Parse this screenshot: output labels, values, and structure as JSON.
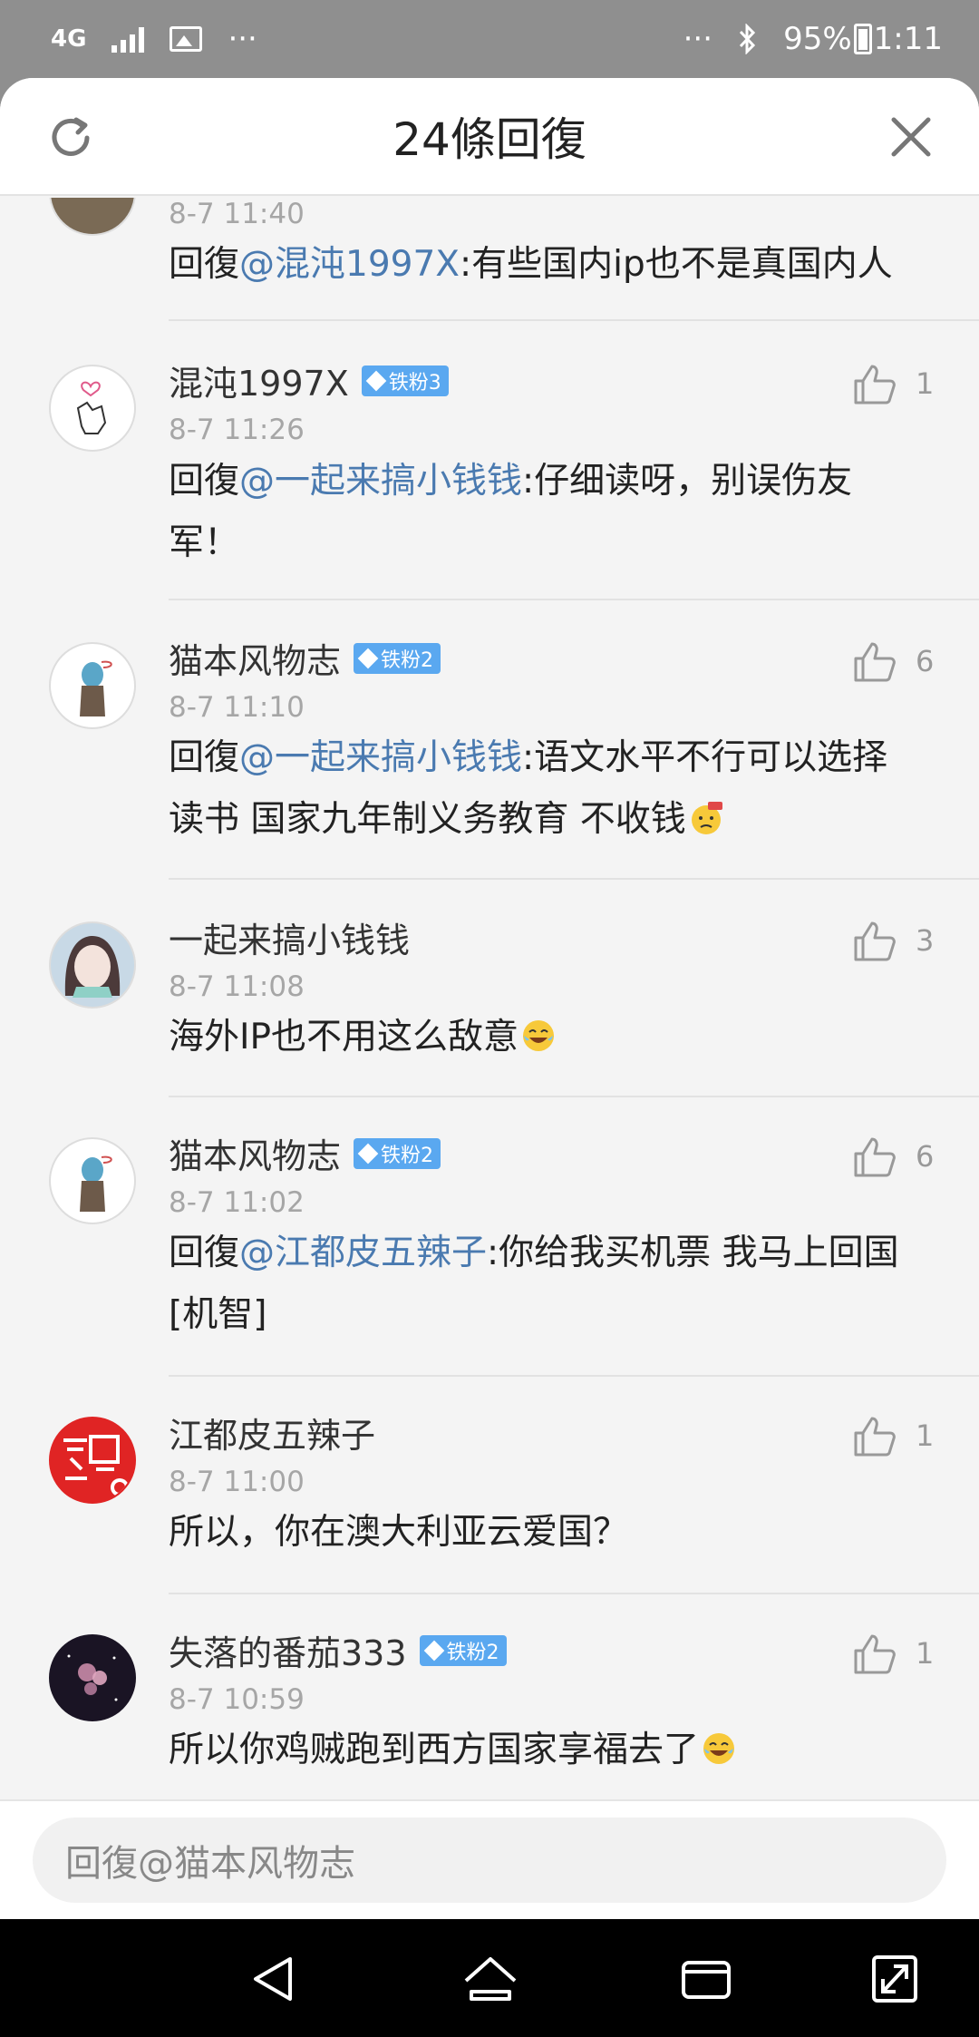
{
  "status_bar": {
    "network": "4G",
    "more_left": "···",
    "more_right": "···",
    "battery": "95%",
    "time": "1:11"
  },
  "header": {
    "title": "24條回復"
  },
  "comments": [
    {
      "username": "",
      "time": "8-7 11:40",
      "reply_prefix": "回復",
      "mention": "@混沌1997X",
      "text": ":有些国内ip也不是真国内人",
      "likes": ""
    },
    {
      "username": "混沌1997X",
      "badge": "铁粉3",
      "time": "8-7 11:26",
      "reply_prefix": "回復",
      "mention": "@一起来搞小钱钱",
      "text": ":仔细读呀，别误伤友军！",
      "likes": "1"
    },
    {
      "username": "猫本风物志",
      "badge": "铁粉2",
      "time": "8-7 11:10",
      "reply_prefix": "回復",
      "mention": "@一起来搞小钱钱",
      "text": ":语文水平不行可以选择读书 国家九年制义务教育 不收钱",
      "likes": "6"
    },
    {
      "username": "一起来搞小钱钱",
      "time": "8-7 11:08",
      "text": "海外IP也不用这么敌意",
      "likes": "3"
    },
    {
      "username": "猫本风物志",
      "badge": "铁粉2",
      "time": "8-7 11:02",
      "reply_prefix": "回復",
      "mention": "@江都皮五辣子",
      "text": ":你给我买机票 我马上回国[机智]",
      "likes": "6"
    },
    {
      "username": "江都皮五辣子",
      "time": "8-7 11:00",
      "text": "所以，你在澳大利亚云爱国？",
      "likes": "1"
    },
    {
      "username": "失落的番茄333",
      "badge": "铁粉2",
      "time": "8-7 10:59",
      "text": "所以你鸡贼跑到西方国家享福去了",
      "likes": "1"
    }
  ],
  "footer": {
    "reply_placeholder": "回復@猫本风物志"
  },
  "icons": {
    "refresh": "refresh-icon",
    "close": "close-icon",
    "like": "thumbs-up-icon",
    "back": "back-triangle-icon",
    "home": "home-icon",
    "recents": "recents-icon",
    "expand": "expand-icon"
  },
  "colors": {
    "mention": "#4a7ab0",
    "badge": "#5aa8f0",
    "timestamp": "#a6a6a6"
  }
}
